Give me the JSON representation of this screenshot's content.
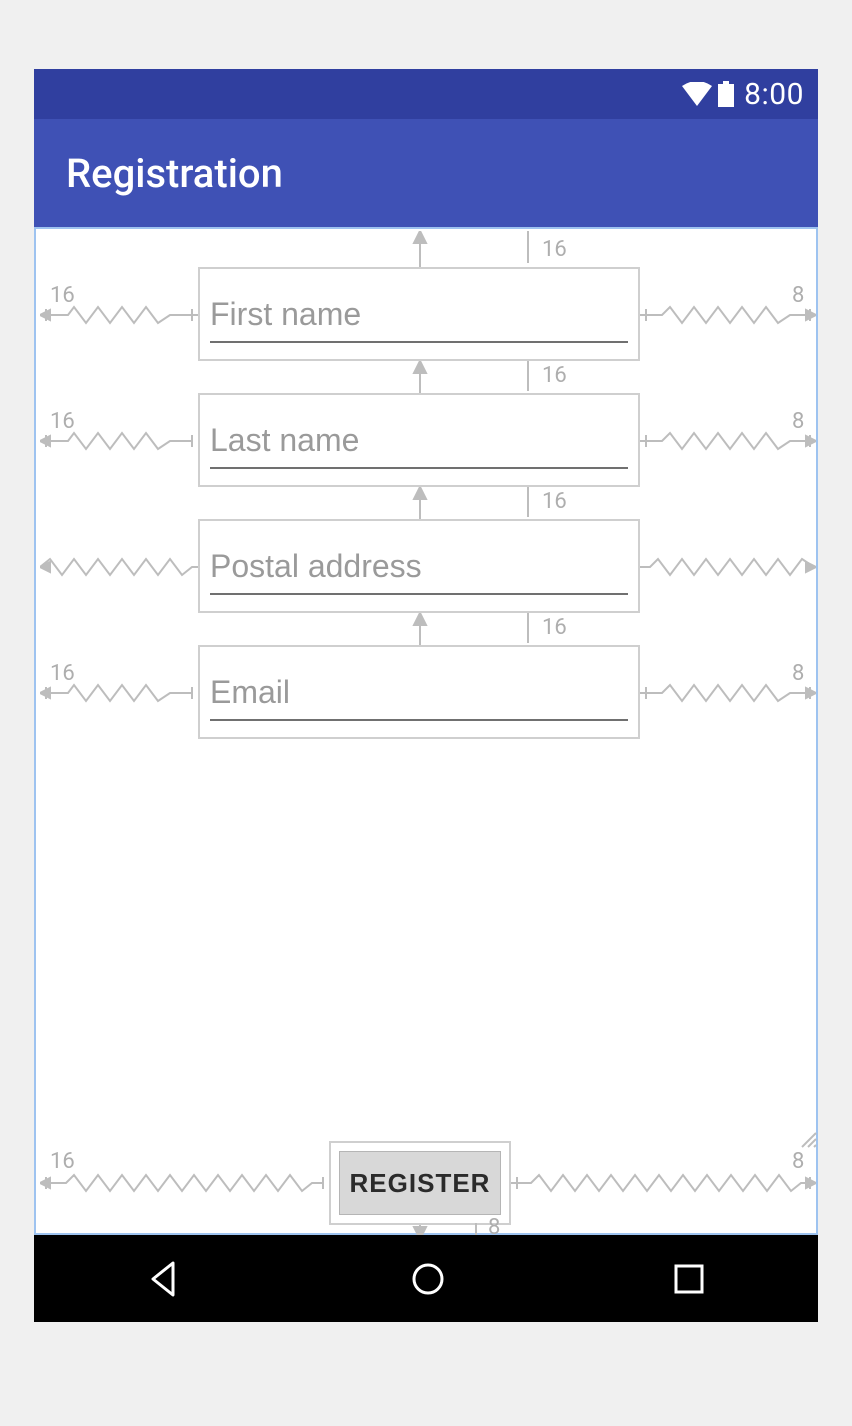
{
  "status_bar": {
    "time": "8:00"
  },
  "app_bar": {
    "title": "Registration"
  },
  "fields": {
    "first_name": {
      "placeholder": "First name",
      "value": ""
    },
    "last_name": {
      "placeholder": "Last name",
      "value": ""
    },
    "postal": {
      "placeholder": "Postal address",
      "value": ""
    },
    "email": {
      "placeholder": "Email",
      "value": ""
    }
  },
  "constraints": {
    "top_margin": "16",
    "vgap1": "16",
    "vgap2": "16",
    "vgap3": "16",
    "bottom_margin": "8",
    "f1_left": "16",
    "f1_right": "8",
    "f2_left": "16",
    "f2_right": "8",
    "f4_left": "16",
    "f4_right": "8",
    "reg_left": "16",
    "reg_right": "8"
  },
  "button": {
    "register": "REGISTER"
  }
}
